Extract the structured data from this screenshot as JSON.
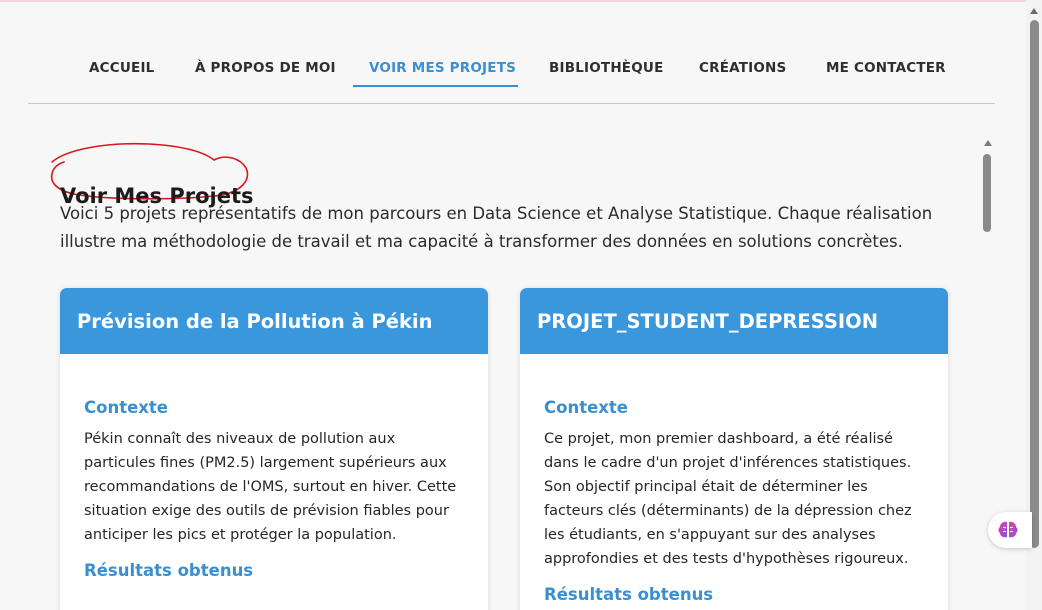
{
  "nav": {
    "items": [
      {
        "label": "ACCUEIL"
      },
      {
        "label": "À PROPOS DE MOI"
      },
      {
        "label": "VOIR MES PROJETS"
      },
      {
        "label": "BIBLIOTHÈQUE"
      },
      {
        "label": "CRÉATIONS"
      },
      {
        "label": "ME CONTACTER"
      }
    ],
    "active": "VOIR MES PROJETS"
  },
  "page": {
    "title": "Voir Mes Projets",
    "intro": "Voici 5 projets représentatifs de mon parcours en Data Science et Analyse Statistique. Chaque réalisation illustre ma méthodologie de travail et ma capacité à transformer des données en solutions concrètes."
  },
  "colors": {
    "accent": "#3a8fd0",
    "card_header": "#3a97dc",
    "annotation": "#d9161b"
  },
  "projects": [
    {
      "title": "Prévision de la Pollution à Pékin",
      "context_label": "Contexte",
      "context_text": "Pékin connaît des niveaux de pollution aux particules fines (PM2.5) largement supérieurs aux recommandations de l'OMS, surtout en hiver. Cette situation exige des outils de prévision fiables pour anticiper les pics et protéger la population.",
      "results_label": "Résultats obtenus"
    },
    {
      "title": "PROJET_STUDENT_DEPRESSION",
      "context_label": "Contexte",
      "context_text": "Ce projet, mon premier dashboard, a été réalisé dans le cadre d'un projet d'inférences statistiques. Son objectif principal était de déterminer les facteurs clés (déterminants) de la dépression chez les étudiants, en s'appuyant sur des analyses approfondies et des tests d'hypothèses rigoureux.",
      "results_label": "Résultats obtenus"
    }
  ],
  "icons": {
    "floating": "brain-icon"
  }
}
